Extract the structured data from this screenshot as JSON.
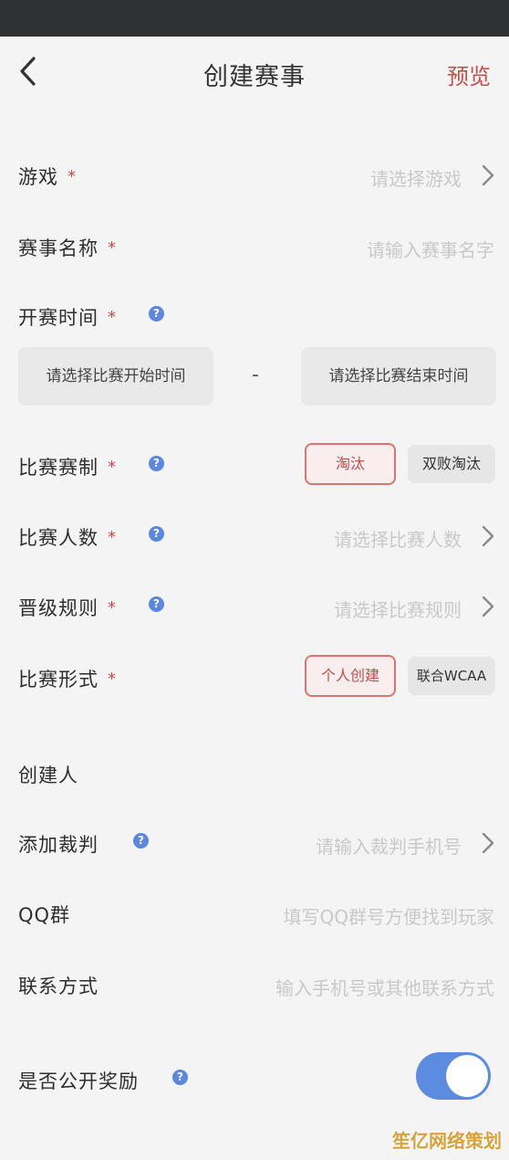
{
  "header": {
    "title": "创建赛事",
    "preview": "预览"
  },
  "required_mark": "*",
  "help_glyph": "?",
  "game": {
    "label": "游戏",
    "placeholder": "请选择游戏"
  },
  "event_name": {
    "label": "赛事名称",
    "placeholder": "请输入赛事名字"
  },
  "start_time": {
    "label": "开赛时间",
    "start_placeholder": "请选择比赛开始时间",
    "separator": "-",
    "end_placeholder": "请选择比赛结束时间"
  },
  "format": {
    "label": "比赛赛制",
    "options": [
      "淘汰",
      "双败淘汰"
    ],
    "selected": "淘汰"
  },
  "players": {
    "label": "比赛人数",
    "placeholder": "请选择比赛人数"
  },
  "promotion": {
    "label": "晋级规则",
    "placeholder": "请选择比赛规则"
  },
  "mode": {
    "label": "比赛形式",
    "options": [
      "个人创建",
      "联合WCAA"
    ],
    "selected": "个人创建"
  },
  "creator": {
    "label": "创建人"
  },
  "referee": {
    "label": "添加裁判",
    "placeholder": "请输入裁判手机号"
  },
  "qq": {
    "label": "QQ群",
    "placeholder": "填写QQ群号方便找到玩家"
  },
  "contact": {
    "label": "联系方式",
    "placeholder": "输入手机号或其他联系方式"
  },
  "reward": {
    "label": "是否公开奖励",
    "enabled": true
  },
  "watermark": "笙亿网络策划",
  "colors": {
    "accent_red": "#c0504d",
    "accent_blue": "#5c8cdf",
    "status_bar": "#2f3235"
  }
}
